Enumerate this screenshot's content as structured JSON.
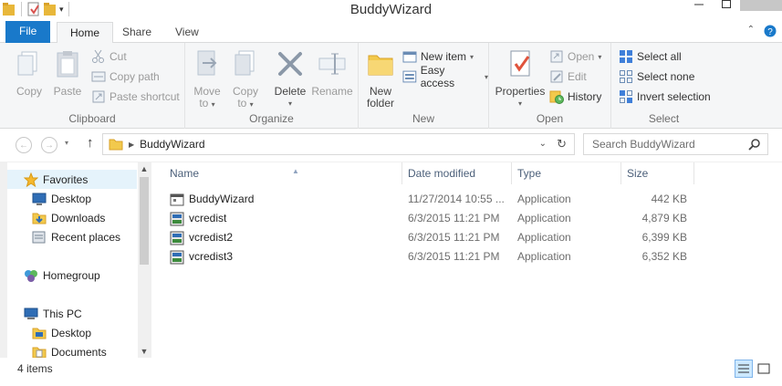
{
  "window": {
    "title": "BuddyWizard"
  },
  "tabs": {
    "file": "File",
    "home": "Home",
    "share": "Share",
    "view": "View"
  },
  "ribbon": {
    "clipboard": {
      "label": "Clipboard",
      "copy": "Copy",
      "paste": "Paste",
      "cut": "Cut",
      "copy_path": "Copy path",
      "paste_shortcut": "Paste shortcut"
    },
    "organize": {
      "label": "Organize",
      "move_to_1": "Move",
      "move_to_2": "to",
      "copy_to_1": "Copy",
      "copy_to_2": "to",
      "delete": "Delete",
      "rename": "Rename"
    },
    "new": {
      "label": "New",
      "new_folder_1": "New",
      "new_folder_2": "folder",
      "new_item": "New item",
      "easy_access": "Easy access"
    },
    "open": {
      "label": "Open",
      "properties": "Properties",
      "open": "Open",
      "edit": "Edit",
      "history": "History"
    },
    "select": {
      "label": "Select",
      "select_all": "Select all",
      "select_none": "Select none",
      "invert_selection": "Invert selection"
    }
  },
  "address": {
    "crumb": "BuddyWizard",
    "search_placeholder": "Search BuddyWizard"
  },
  "nav": {
    "favorites": "Favorites",
    "desktop": "Desktop",
    "downloads": "Downloads",
    "recent_places": "Recent places",
    "homegroup": "Homegroup",
    "this_pc": "This PC",
    "pc_desktop": "Desktop",
    "pc_documents": "Documents"
  },
  "columns": {
    "name": "Name",
    "date": "Date modified",
    "type": "Type",
    "size": "Size"
  },
  "files": [
    {
      "name": "BuddyWizard",
      "date": "11/27/2014 10:55 ...",
      "type": "Application",
      "size": "442 KB"
    },
    {
      "name": "vcredist",
      "date": "6/3/2015 11:21 PM",
      "type": "Application",
      "size": "4,879 KB"
    },
    {
      "name": "vcredist2",
      "date": "6/3/2015 11:21 PM",
      "type": "Application",
      "size": "6,399 KB"
    },
    {
      "name": "vcredist3",
      "date": "6/3/2015 11:21 PM",
      "type": "Application",
      "size": "6,352 KB"
    }
  ],
  "status": {
    "count": "4 items"
  },
  "colors": {
    "file_tab": "#1979ca",
    "nav_selected": "#e5f3fb",
    "folder": "#f2c94c"
  }
}
